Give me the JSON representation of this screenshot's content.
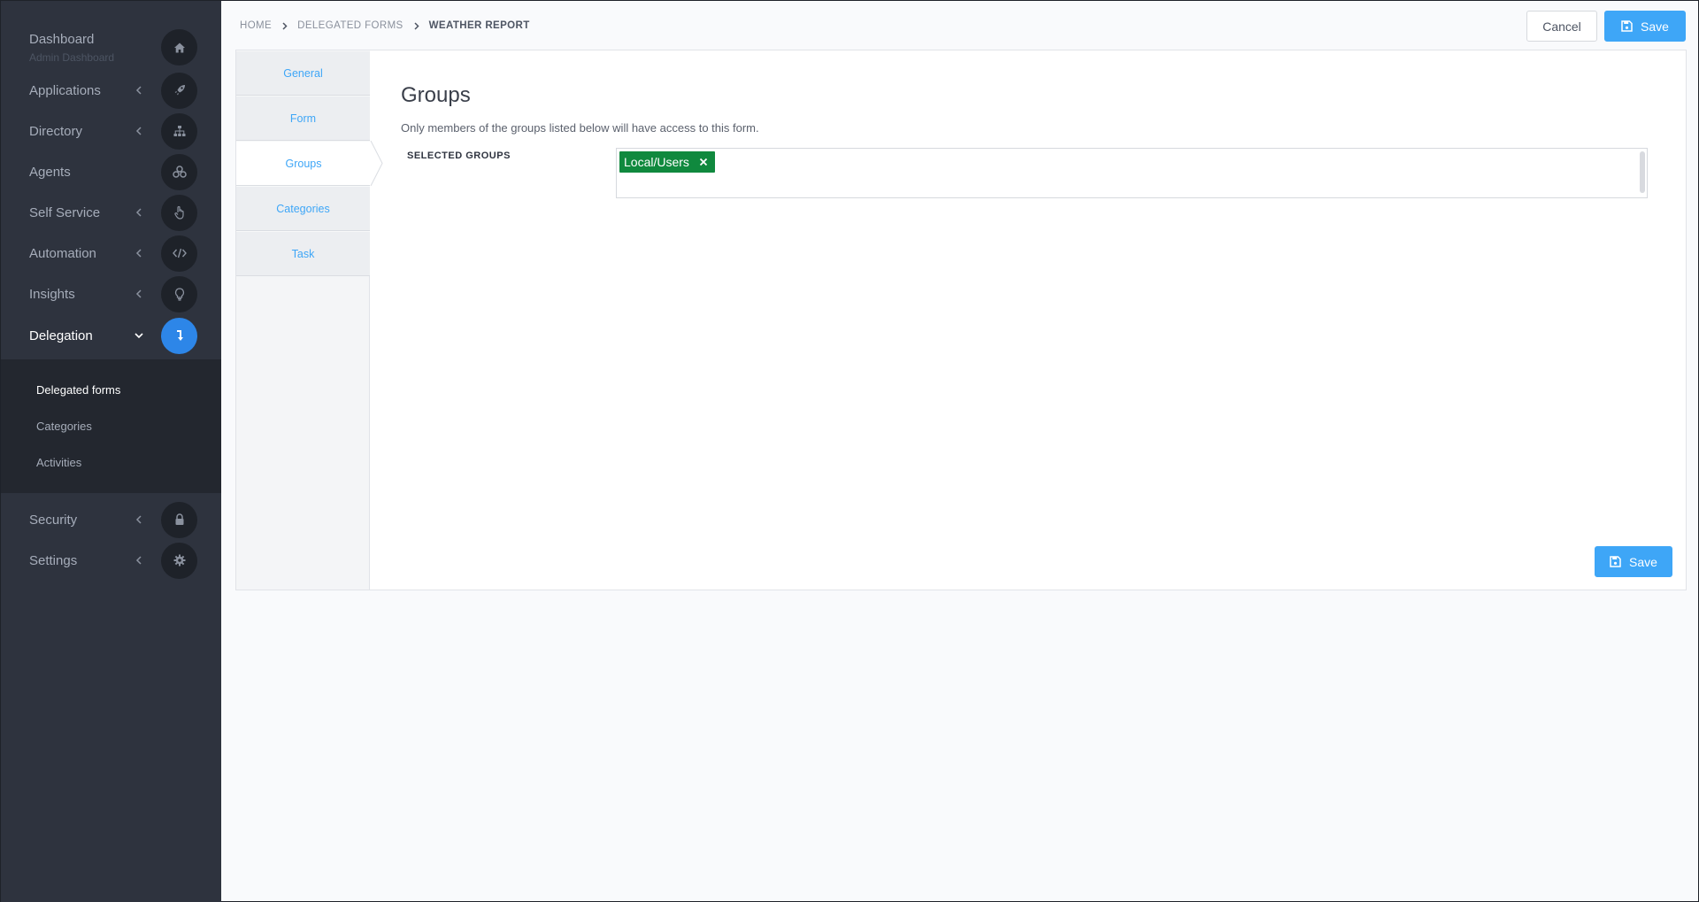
{
  "sidebar": {
    "dashboard": {
      "label": "Dashboard",
      "sublabel": "Admin Dashboard",
      "icon": "home-icon"
    },
    "items": [
      {
        "label": "Applications",
        "icon": "rocket-icon",
        "expandable": true
      },
      {
        "label": "Directory",
        "icon": "sitemap-icon",
        "expandable": true
      },
      {
        "label": "Agents",
        "icon": "agents-icon",
        "expandable": false
      },
      {
        "label": "Self Service",
        "icon": "hand-pointer-icon",
        "expandable": true
      },
      {
        "label": "Automation",
        "icon": "code-icon",
        "expandable": true
      },
      {
        "label": "Insights",
        "icon": "lightbulb-icon",
        "expandable": true
      },
      {
        "label": "Delegation",
        "icon": "delegation-icon",
        "expandable": true,
        "active": true,
        "expanded": true
      }
    ],
    "delegation_submenu": [
      {
        "label": "Delegated forms",
        "active": true
      },
      {
        "label": "Categories",
        "active": false
      },
      {
        "label": "Activities",
        "active": false
      }
    ],
    "bottom_items": [
      {
        "label": "Security",
        "icon": "lock-icon",
        "expandable": true
      },
      {
        "label": "Settings",
        "icon": "gear-icon",
        "expandable": true
      }
    ]
  },
  "breadcrumb": {
    "home": "HOME",
    "parent": "DELEGATED FORMS",
    "current": "WEATHER REPORT"
  },
  "header": {
    "cancel_label": "Cancel",
    "save_label": "Save"
  },
  "tabs": [
    {
      "label": "General",
      "active": false
    },
    {
      "label": "Form",
      "active": false
    },
    {
      "label": "Groups",
      "active": true
    },
    {
      "label": "Categories",
      "active": false
    },
    {
      "label": "Task",
      "active": false
    }
  ],
  "content": {
    "title": "Groups",
    "description": "Only members of the groups listed below will have access to this form.",
    "selected_groups_label": "SELECTED GROUPS",
    "selected_groups": [
      "Local/Users"
    ],
    "save_label": "Save"
  },
  "colors": {
    "sidebar_bg": "#2e333e",
    "accent": "#3ea6f7",
    "active_nav": "#2d86e8",
    "tag_green": "#10893e"
  }
}
